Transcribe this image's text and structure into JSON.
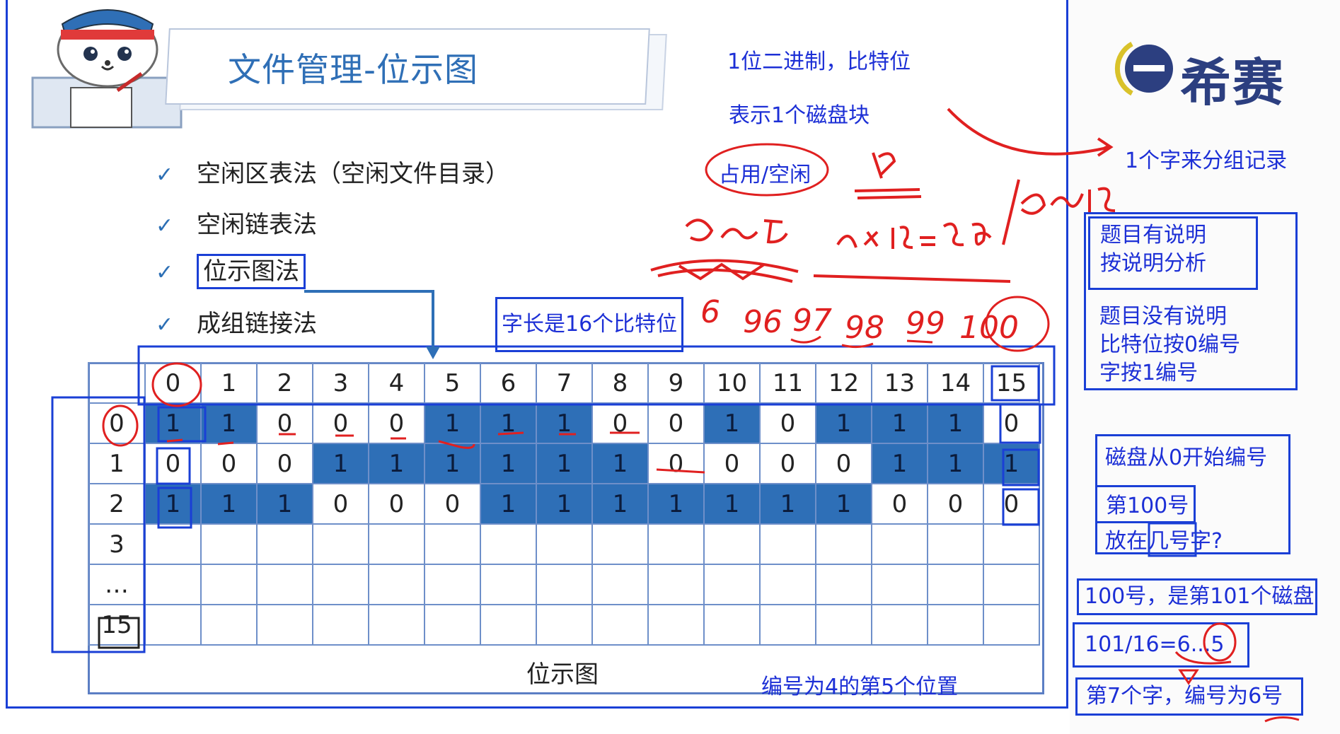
{
  "title": "文件管理-位示图",
  "logo": {
    "text": "希赛"
  },
  "bullets": [
    {
      "label": "空闲区表法（空闲文件目录）"
    },
    {
      "label": "空闲链表法"
    },
    {
      "label": "位示图法"
    },
    {
      "label": "成组链接法"
    }
  ],
  "notes": {
    "bit": "1位二进制，比特位",
    "block": "表示1个磁盘块",
    "state": "占用/空闲",
    "word_length": "字长是16个比特位",
    "group": "1个字来分组记录",
    "explained": "题目有说明\n按说明分析",
    "unexplained": "题目没有说明\n比特位按0编号\n字按1编号",
    "disk_from_zero": "磁盘从0开始编号",
    "no100": "第100号",
    "which_word": "放在几号字?",
    "is_101": "100号，是第101个磁盘",
    "calc": "101/16=6...5",
    "word7": "第7个字，编号为6号",
    "position5": "编号为4的第5个位置"
  },
  "bitmap": {
    "columns": [
      "0",
      "1",
      "2",
      "3",
      "4",
      "5",
      "6",
      "7",
      "8",
      "9",
      "10",
      "11",
      "12",
      "13",
      "14",
      "15"
    ],
    "row_labels": [
      "0",
      "1",
      "2",
      "3",
      "…",
      "15"
    ],
    "rows": [
      [
        "1",
        "1",
        "0",
        "0",
        "0",
        "1",
        "1",
        "1",
        "0",
        "0",
        "1",
        "0",
        "1",
        "1",
        "1",
        "0"
      ],
      [
        "0",
        "0",
        "0",
        "1",
        "1",
        "1",
        "1",
        "1",
        "1",
        "0",
        "0",
        "0",
        "0",
        "1",
        "1",
        "1"
      ],
      [
        "1",
        "1",
        "1",
        "0",
        "0",
        "0",
        "1",
        "1",
        "1",
        "1",
        "1",
        "1",
        "1",
        "0",
        "0",
        "0"
      ],
      [
        "",
        "",
        "",
        "",
        "",
        "",
        "",
        "",
        "",
        "",
        "",
        "",
        "",
        "",
        "",
        ""
      ],
      [
        "",
        "",
        "",
        "",
        "",
        "",
        "",
        "",
        "",
        "",
        "",
        "",
        "",
        "",
        "",
        ""
      ],
      [
        "",
        "",
        "",
        "",
        "",
        "",
        "",
        "",
        "",
        "",
        "",
        "",
        "",
        "",
        "",
        ""
      ]
    ],
    "filled_rows": [
      [
        1,
        1,
        0,
        0,
        0,
        1,
        1,
        1,
        0,
        0,
        1,
        0,
        1,
        1,
        1,
        0
      ],
      [
        0,
        0,
        0,
        1,
        1,
        1,
        1,
        1,
        1,
        0,
        0,
        0,
        0,
        1,
        1,
        1
      ],
      [
        1,
        1,
        1,
        0,
        0,
        0,
        1,
        1,
        1,
        1,
        1,
        1,
        1,
        0,
        0,
        0
      ]
    ],
    "caption": "位示图"
  },
  "handwriting": {
    "fraction": "1/8",
    "range_a": "0~5",
    "product": "6x16=96",
    "range_b": "0~15",
    "seq": [
      "6",
      "96",
      "97",
      "98",
      "99",
      "100"
    ]
  },
  "colors": {
    "accent": "#1a3fd6",
    "fill": "#2e6fb7",
    "ink": "#e02020",
    "title": "#2f6fb6"
  }
}
